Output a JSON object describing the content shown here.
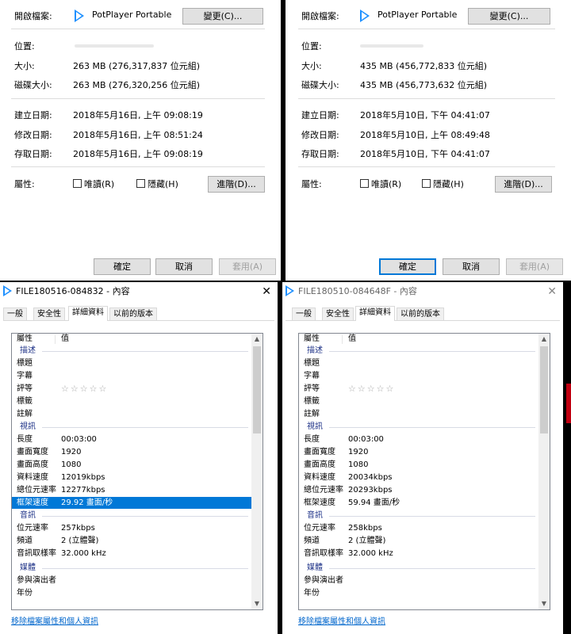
{
  "general_left": {
    "open_with_label": "開啟檔案:",
    "app_name": "PotPlayer Portable",
    "change_btn": "變更(C)...",
    "location_label": "位置:",
    "size_label": "大小:",
    "size_value": "263 MB (276,317,837 位元組)",
    "disk_size_label": "磁碟大小:",
    "disk_size_value": "263 MB (276,320,256 位元組)",
    "created_label": "建立日期:",
    "created_value": "2018年5月16日, 上午 09:08:19",
    "modified_label": "修改日期:",
    "modified_value": "2018年5月16日, 上午 08:51:24",
    "accessed_label": "存取日期:",
    "accessed_value": "2018年5月16日, 上午 09:08:19",
    "attr_label": "屬性:",
    "readonly_label": "唯讀(R)",
    "hidden_label": "隱藏(H)",
    "advanced_btn": "進階(D)...",
    "ok_btn": "確定",
    "cancel_btn": "取消",
    "apply_btn": "套用(A)"
  },
  "general_right": {
    "open_with_label": "開啟檔案:",
    "app_name": "PotPlayer Portable",
    "change_btn": "變更(C)...",
    "location_label": "位置:",
    "size_label": "大小:",
    "size_value": "435 MB (456,772,833 位元組)",
    "disk_size_label": "磁碟大小:",
    "disk_size_value": "435 MB (456,773,632 位元組)",
    "created_label": "建立日期:",
    "created_value": "2018年5月10日, 下午 04:41:07",
    "modified_label": "修改日期:",
    "modified_value": "2018年5月10日, 上午 08:49:48",
    "accessed_label": "存取日期:",
    "accessed_value": "2018年5月10日, 下午 04:41:07",
    "attr_label": "屬性:",
    "readonly_label": "唯讀(R)",
    "hidden_label": "隱藏(H)",
    "advanced_btn": "進階(D)...",
    "ok_btn": "確定",
    "cancel_btn": "取消",
    "apply_btn": "套用(A)"
  },
  "details_left": {
    "title": "FILE180516-084832 - 內容",
    "close": "✕",
    "tabs": [
      "一般",
      "安全性",
      "詳細資料",
      "以前的版本"
    ],
    "col_property": "屬性",
    "col_value": "值",
    "group_desc": "描述",
    "title_label": "標題",
    "subtitle_label": "字幕",
    "rating_label": "評等",
    "rating_stars": "☆☆☆☆☆",
    "tags_label": "標籤",
    "comments_label": "註解",
    "group_video": "視訊",
    "length_label": "長度",
    "length_value": "00:03:00",
    "width_label": "畫面寬度",
    "width_value": "1920",
    "height_label": "畫面高度",
    "height_value": "1080",
    "datarate_label": "資料速度",
    "datarate_value": "12019kbps",
    "bitrate_label": "總位元速率",
    "bitrate_value": "12277kbps",
    "framerate_label": "框架速度",
    "framerate_value": "29.92 畫面/秒",
    "group_audio": "音訊",
    "abitrate_label": "位元速率",
    "abitrate_value": "257kbps",
    "channels_label": "頻道",
    "channels_value": "2 (立體聲)",
    "samplerate_label": "音訊取樣率",
    "samplerate_value": "32.000 kHz",
    "group_media": "媒體",
    "artists_label": "參與演出者",
    "year_label": "年份",
    "remove_link": "移除檔案屬性和個人資訊"
  },
  "details_right": {
    "title": "FILE180510-084648F - 內容",
    "close": "✕",
    "tabs": [
      "一般",
      "安全性",
      "詳細資料",
      "以前的版本"
    ],
    "col_property": "屬性",
    "col_value": "值",
    "group_desc": "描述",
    "title_label": "標題",
    "subtitle_label": "字幕",
    "rating_label": "評等",
    "rating_stars": "☆☆☆☆☆",
    "tags_label": "標籤",
    "comments_label": "註解",
    "group_video": "視訊",
    "length_label": "長度",
    "length_value": "00:03:00",
    "width_label": "畫面寬度",
    "width_value": "1920",
    "height_label": "畫面高度",
    "height_value": "1080",
    "datarate_label": "資料速度",
    "datarate_value": "20034kbps",
    "bitrate_label": "總位元速率",
    "bitrate_value": "20293kbps",
    "framerate_label": "框架速度",
    "framerate_value": "59.94 畫面/秒",
    "group_audio": "音訊",
    "abitrate_label": "位元速率",
    "abitrate_value": "258kbps",
    "channels_label": "頻道",
    "channels_value": "2 (立體聲)",
    "samplerate_label": "音訊取樣率",
    "samplerate_value": "32.000 kHz",
    "group_media": "媒體",
    "artists_label": "參與演出者",
    "year_label": "年份",
    "remove_link": "移除檔案屬性和個人資訊"
  }
}
